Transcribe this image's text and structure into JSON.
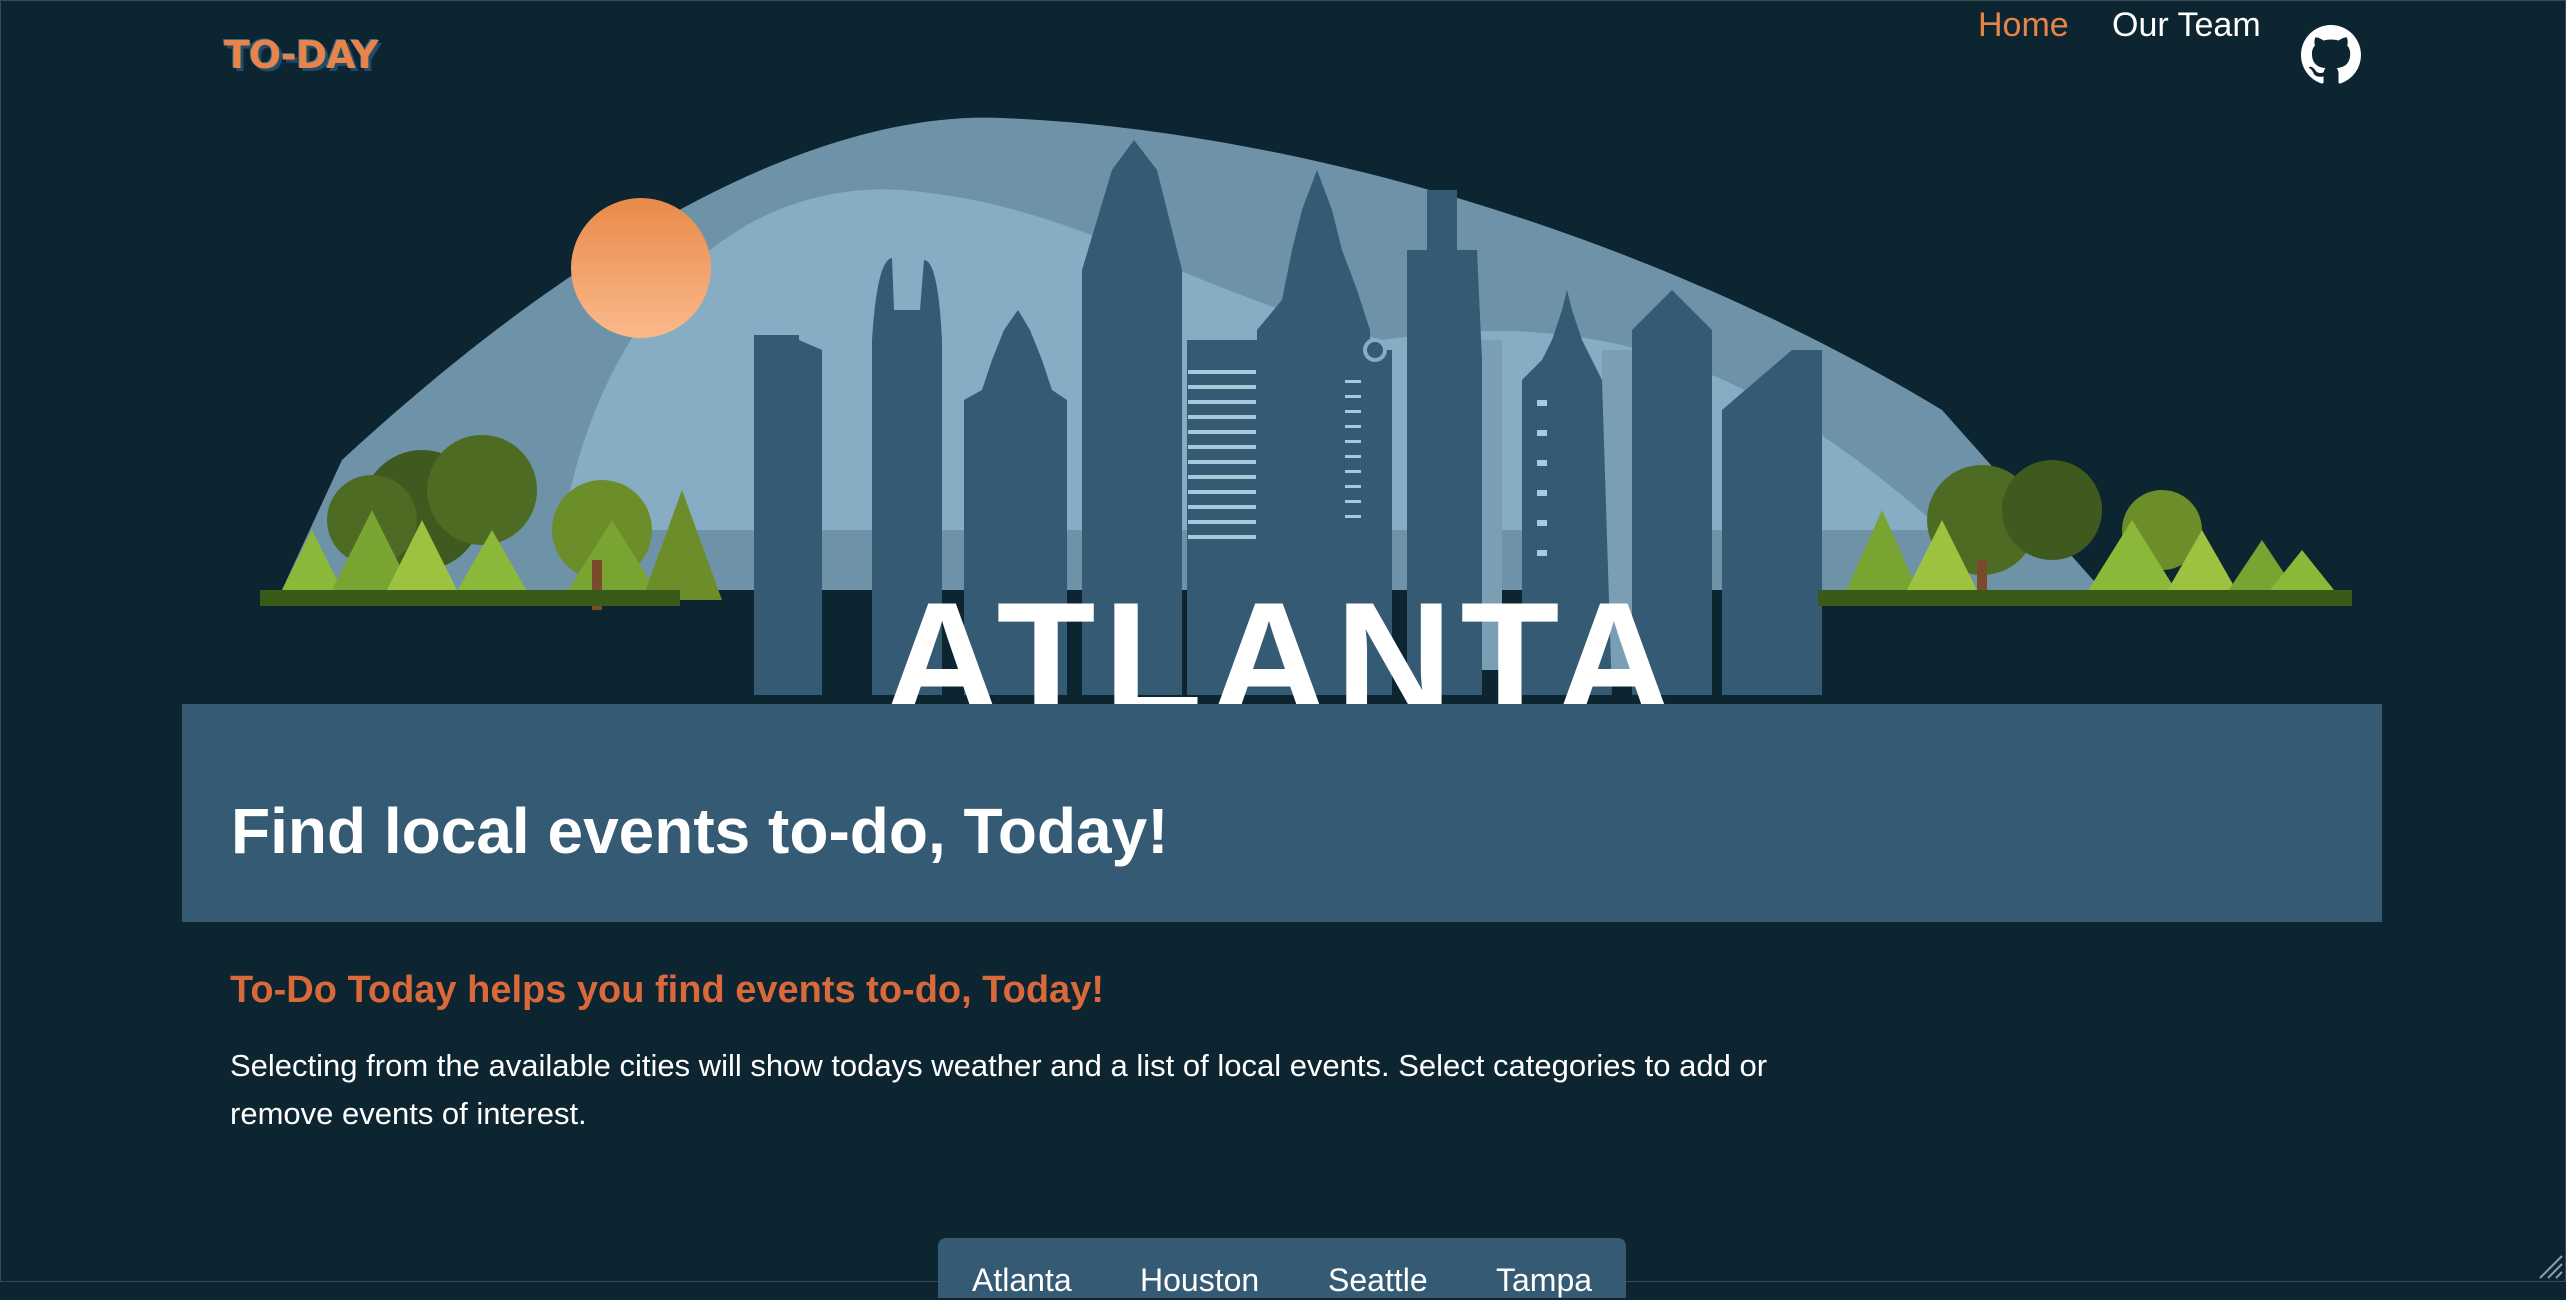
{
  "header": {
    "logo_text": "TO-DAY",
    "nav": [
      {
        "label": "Home",
        "active": true
      },
      {
        "label": "Our Team",
        "active": false
      }
    ],
    "github_icon": "github-icon"
  },
  "hero": {
    "city": "ATLANTA",
    "headline": "Find local events to-do, Today!"
  },
  "about": {
    "heading": "To-Do Today helps you find events to-do, Today!",
    "body": "Selecting from the available cities will show todays weather and a list of local events. Select categories to add or remove events of interest."
  },
  "cities": [
    "Atlanta",
    "Houston",
    "Seattle",
    "Tampa"
  ],
  "colors": {
    "background": "#0d2431",
    "accent": "#e8844a",
    "heading_accent": "#d9683a",
    "panel": "#355a74"
  }
}
